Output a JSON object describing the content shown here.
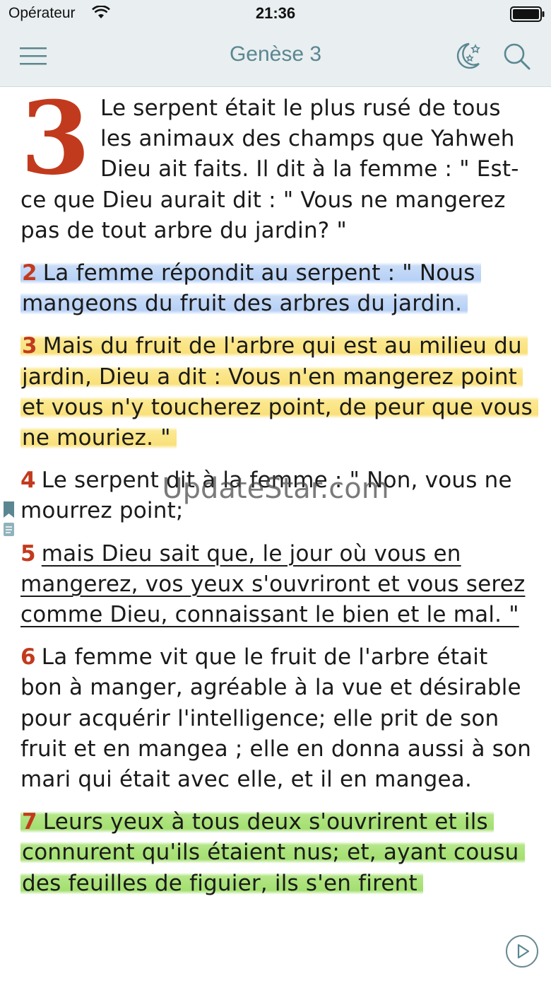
{
  "status_bar": {
    "carrier": "Opérateur",
    "time": "21:36"
  },
  "nav": {
    "title": "Genèse 3",
    "icons": [
      "menu-icon",
      "night-mode-icon",
      "search-icon"
    ]
  },
  "chapter": {
    "number": "3",
    "first_verse": "Le serpent était le plus rusé de tous les animaux des champs que Yahweh Dieu ait faits. Il dit à la femme : \" Est-ce que Dieu aurait dit : \" Vous ne mangerez pas de tout arbre du jardin? \"",
    "verses": [
      {
        "num": "2",
        "text": "La femme répondit au serpent : \" Nous mangeons du fruit des arbres du jardin.",
        "style": "highlight-blue"
      },
      {
        "num": "3",
        "text": "Mais du fruit de l'arbre qui est au milieu du jardin, Dieu a dit : Vous n'en mangerez point et vous n'y toucherez point, de peur que vous ne mouriez. \"",
        "style": "highlight-yellow"
      },
      {
        "num": "4",
        "text": "Le serpent dit à la femme : \" Non, vous ne mourrez point;",
        "style": "plain"
      },
      {
        "num": "5",
        "text": "mais Dieu sait que, le jour où vous en mangerez, vos yeux s'ouvriront et vous serez comme Dieu, connaissant le bien et le mal. \"",
        "style": "underline"
      },
      {
        "num": "6",
        "text": "La femme vit que le fruit de l'arbre était bon à manger, agréable à la vue et désirable pour acquérir l'intelligence; elle prit de son fruit et en mangea ; elle en donna aussi à son mari qui était avec elle, et il en mangea.",
        "style": "plain"
      },
      {
        "num": "7",
        "text": "Leurs yeux à tous deux s'ouvrirent et ils connurent qu'ils étaient nus; et, ayant cousu des feuilles de figuier, ils s'en firent",
        "style": "highlight-green"
      }
    ]
  },
  "watermark": "UpdateStar.com",
  "colors": {
    "accent": "#c23a1d",
    "nav_title": "#5a8791",
    "highlight_blue": "#b6d0f6",
    "highlight_yellow": "#f9e07a",
    "highlight_green": "#a3df70"
  }
}
